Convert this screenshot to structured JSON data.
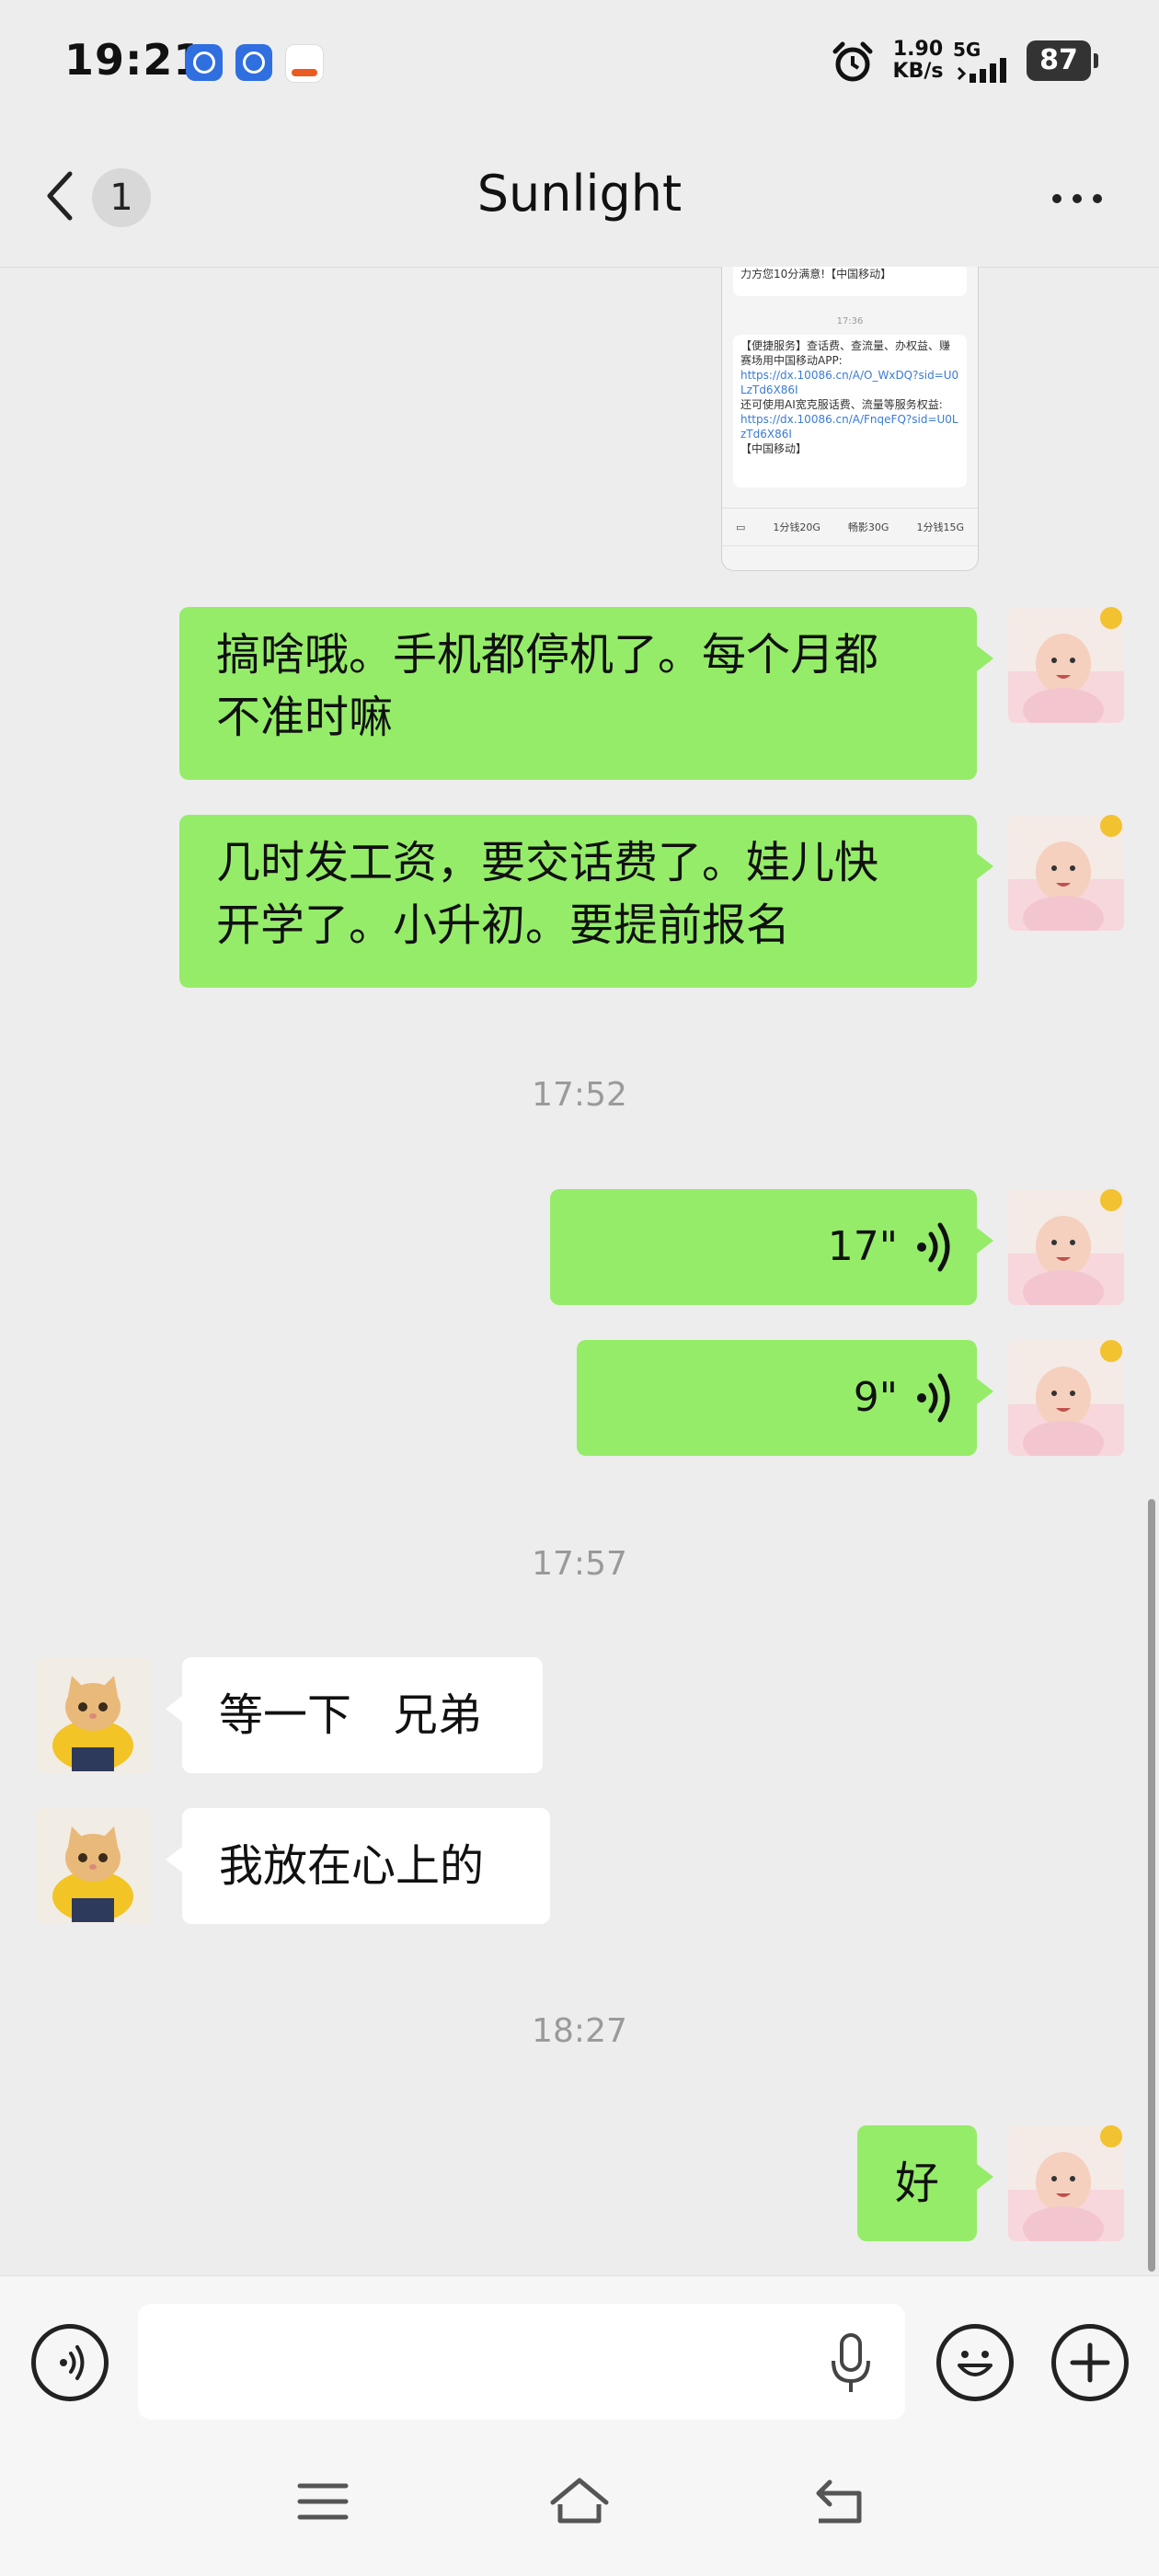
{
  "status_bar": {
    "time": "19:21",
    "net_speed_value": "1.90",
    "net_speed_unit": "KB/s",
    "network": "5G",
    "battery": "87",
    "icons": [
      "k-app-icon",
      "k-app-icon",
      "news-app-icon",
      "alarm-icon",
      "signal-icon",
      "battery-icon"
    ]
  },
  "header": {
    "back_icon": "chevron-left-icon",
    "unread_count": "1",
    "title": "Sunlight",
    "more_icon": "more-dots-icon"
  },
  "shared_screenshot": {
    "line_a": "力方您10分满意!【中国移动】",
    "time": "17:36",
    "line_b1": "【便捷服务】查话费、查流量、办权益、赚",
    "line_b2": "赛场用中国移动APP:",
    "link_1": "https://dx.10086.cn/A/O_WxDQ?sid=U0LzTd6X86I",
    "line_b3": "还可使用AI宽克服话费、流量等服务权益:",
    "link_2": "https://dx.10086.cn/A/FnqeFQ?sid=U0LzTd6X86I",
    "line_b4": "【中国移动】",
    "tabs": [
      "1分钱20G",
      "畅影30G",
      "1分钱15G"
    ]
  },
  "messages": [
    {
      "side": "me",
      "type": "text",
      "lines": [
        "搞啥哦。手机都停机了。每个月都",
        "不准时嘛"
      ]
    },
    {
      "side": "me",
      "type": "text",
      "lines": [
        "几时发工资，要交话费了。娃儿快",
        "开学了。小升初。要提前报名"
      ]
    },
    {
      "type": "time",
      "text": "17:52"
    },
    {
      "side": "me",
      "type": "voice",
      "duration": "17\""
    },
    {
      "side": "me",
      "type": "voice",
      "duration": "9\""
    },
    {
      "type": "time",
      "text": "17:57"
    },
    {
      "side": "other",
      "type": "text",
      "lines": [
        "等一下   兄弟"
      ]
    },
    {
      "side": "other",
      "type": "text",
      "lines": [
        "我放在心上的"
      ]
    },
    {
      "type": "time",
      "text": "18:27"
    },
    {
      "side": "me",
      "type": "text",
      "lines": [
        "好"
      ]
    }
  ],
  "input_bar": {
    "placeholder": "",
    "voice_toggle_icon": "voice-mode-icon",
    "mic_icon": "microphone-icon",
    "emoji_icon": "emoji-icon",
    "plus_icon": "plus-icon"
  },
  "system_nav": {
    "icons": [
      "menu-icon",
      "home-icon",
      "back-icon"
    ]
  },
  "colors": {
    "background": "#ededed",
    "my_bubble": "#95ec69",
    "other_bubble": "#ffffff",
    "timestamp": "#9a9a9a"
  }
}
